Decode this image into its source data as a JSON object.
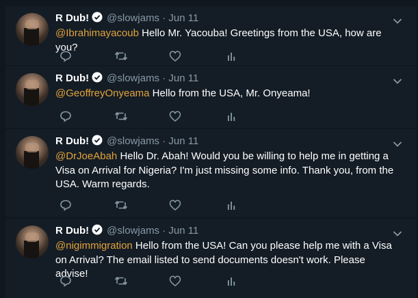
{
  "tweets": [
    {
      "name": "R Dub!",
      "handle": "@slowjams",
      "separator": "·",
      "date": "Jun 11",
      "mention": "@Ibrahimayacoub",
      "text": " Hello Mr. Yacouba!  Greetings from the USA, how are you?"
    },
    {
      "name": "R Dub!",
      "handle": "@slowjams",
      "separator": "·",
      "date": "Jun 11",
      "mention": "@GeoffreyOnyeama",
      "text": " Hello from the USA, Mr. Onyeama!"
    },
    {
      "name": "R Dub!",
      "handle": "@slowjams",
      "separator": "·",
      "date": "Jun 11",
      "mention": "@DrJoeAbah",
      "text": " Hello Dr. Abah! Would you be willing to help me in getting a Visa on Arrival for Nigeria? I'm just missing some info. Thank you, from the USA. Warm regards."
    },
    {
      "name": "R Dub!",
      "handle": "@slowjams",
      "separator": "·",
      "date": "Jun 11",
      "mention": "@nigimmigration",
      "text": " Hello from the USA! Can you please help me with a Visa on Arrival? The email listed to send documents doesn't work. Please advise!"
    }
  ],
  "icons": [
    "verified-badge-icon",
    "chevron-down-icon",
    "reply-icon",
    "retweet-icon",
    "like-icon",
    "analytics-icon"
  ],
  "colors": {
    "background": "#10171e",
    "tweet_background": "#141d26",
    "mention": "#e3a33a",
    "secondary_text": "#8899a6"
  }
}
